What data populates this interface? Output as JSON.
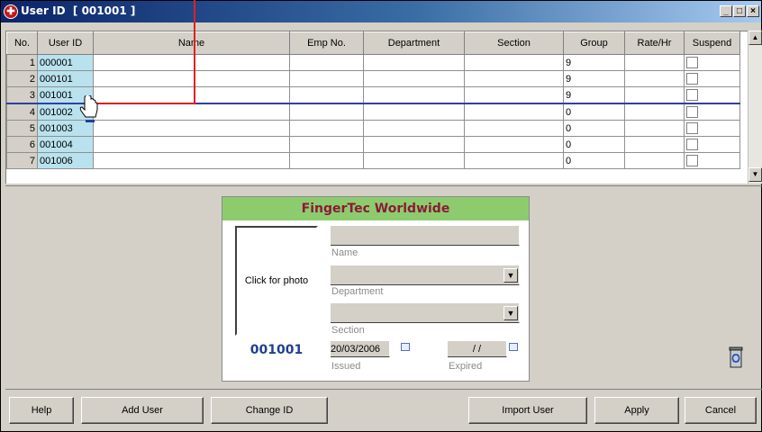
{
  "window": {
    "title": "User ID  [ 001001 ]",
    "min": "_",
    "max": "□",
    "close": "×"
  },
  "grid": {
    "columns": [
      "No.",
      "User ID",
      "Name",
      "Emp No.",
      "Department",
      "Section",
      "Group",
      "Rate/Hr",
      "Suspend"
    ],
    "rows": [
      {
        "no": "1",
        "uid": "000001",
        "group": "9"
      },
      {
        "no": "2",
        "uid": "000101",
        "group": "9"
      },
      {
        "no": "3",
        "uid": "001001",
        "group": "9"
      },
      {
        "no": "4",
        "uid": "001002",
        "group": "0"
      },
      {
        "no": "5",
        "uid": "001003",
        "group": "0"
      },
      {
        "no": "6",
        "uid": "001004",
        "group": "0"
      },
      {
        "no": "7",
        "uid": "001006",
        "group": "0"
      }
    ]
  },
  "card": {
    "header": "FingerTec Worldwide",
    "photo_label": "Click for photo",
    "user_id": "001001",
    "name_label": "Name",
    "department_label": "Department",
    "section_label": "Section",
    "issued_value": "20/03/2006",
    "issued_label": "Issued",
    "expired_value": "/ /",
    "expired_label": "Expired"
  },
  "buttons": {
    "help": "Help",
    "add_user": "Add User",
    "change_id": "Change ID",
    "import_user": "Import User",
    "apply": "Apply",
    "cancel": "Cancel"
  },
  "icons": {
    "title": "fingertec-clock-icon",
    "trash": "recycle-bin-icon",
    "pointer": "hand-pointer-icon"
  },
  "colors": {
    "title_start": "#0a246a",
    "card_header": "#8dcc6e",
    "card_title": "#8b1a3a",
    "userid_cell": "#b9e2ee",
    "annotation": "#e02020"
  }
}
